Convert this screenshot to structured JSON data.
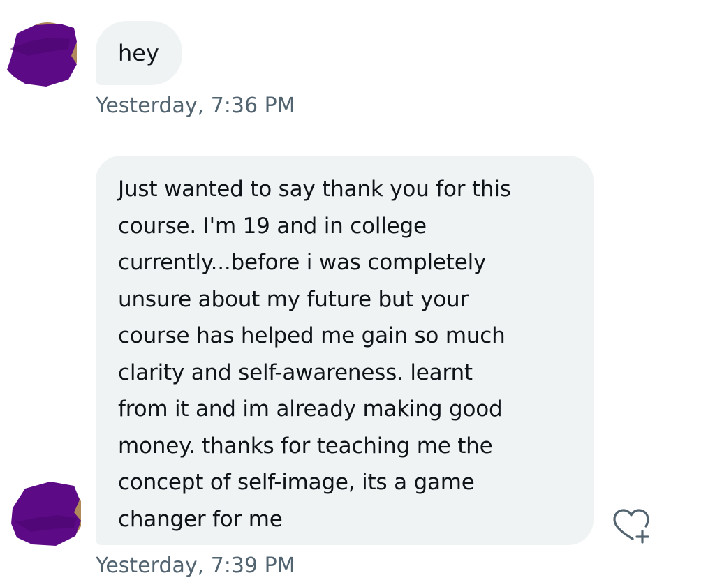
{
  "messages": [
    {
      "text": "hey",
      "timestamp": "Yesterday, 7:36 PM"
    },
    {
      "text": "Just wanted to say thank you for this\ncourse. I'm 19 and in college\ncurrently...before i was completely\nunsure about my future but your\ncourse has helped me gain so much\nclarity and self-awareness. learnt\nfrom it and im already making good\nmoney. thanks for teaching me the\nconcept of self-image, its a game\nchanger for me",
      "timestamp": "Yesterday, 7:39 PM"
    }
  ],
  "icons": {
    "reaction": "heart-plus-icon",
    "avatar": "redacted-avatar"
  },
  "colors": {
    "bubble": "#eff3f4",
    "text": "#0f1419",
    "timestamp": "#536471",
    "redaction": "#5c0a86"
  }
}
